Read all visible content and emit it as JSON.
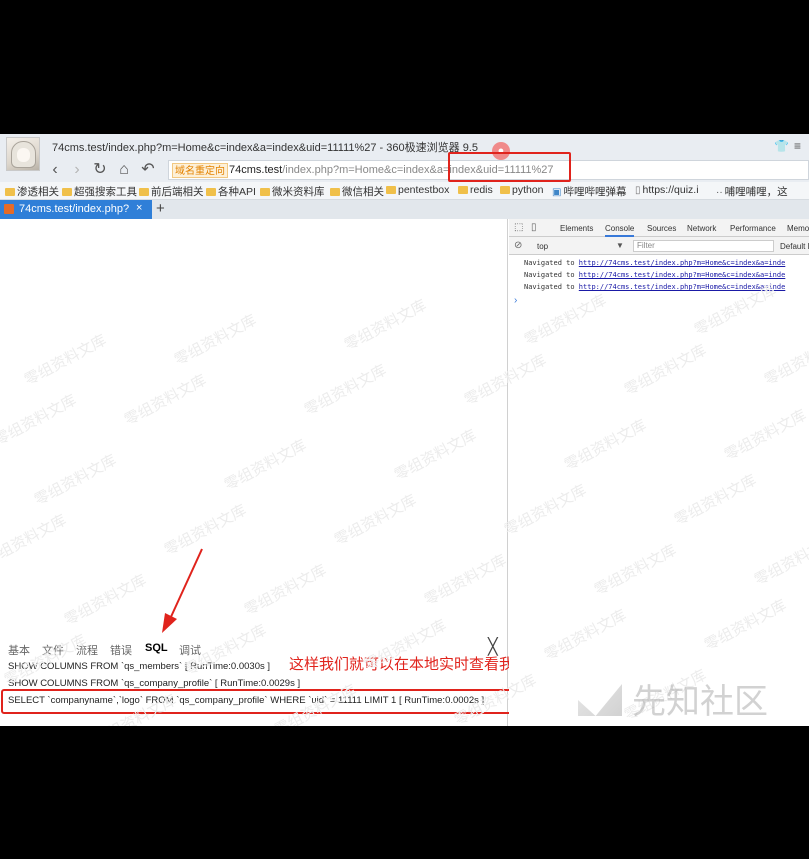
{
  "window": {
    "title": "74cms.test/index.php?m=Home&c=index&a=index&uid=11111%27 - 360极速浏览器 9.5"
  },
  "nav": {
    "back_icon": "‹",
    "forward_icon": "›",
    "reload_icon": "↻",
    "home_icon": "⌂",
    "undo_icon": "↶",
    "redirect_tag": "域名重定向",
    "url_host": "74cms.test",
    "url_path": "/index.php?m=Home&c=index&a=index&uid=11111%27"
  },
  "bookmarks": [
    {
      "label": "渗透相关",
      "icon": "folder"
    },
    {
      "label": "超强搜索工具",
      "icon": "folder"
    },
    {
      "label": "前后端相关",
      "icon": "folder"
    },
    {
      "label": "各种API",
      "icon": "folder"
    },
    {
      "label": "微米资料库",
      "icon": "folder"
    },
    {
      "label": "微信相关",
      "icon": "folder"
    },
    {
      "label": "pentestbox",
      "icon": "folder"
    },
    {
      "label": "redis",
      "icon": "folder"
    },
    {
      "label": "python",
      "icon": "folder"
    },
    {
      "label": "哔哩哔哩弹幕",
      "icon": "bilibili"
    },
    {
      "label": "https://quiz.i",
      "icon": "page"
    },
    {
      "label": "哺哩哺哩，这",
      "icon": "emoticon"
    }
  ],
  "tab": {
    "label": "74cms.test/index.php?",
    "close": "×",
    "new_tab": "+"
  },
  "annotation": "这样我们就可以在本地实时查看我们的代码",
  "debug": {
    "tabs": [
      "基本",
      "文件",
      "流程",
      "错误",
      "SQL",
      "调试"
    ],
    "active_tab": "SQL",
    "close": "╳",
    "sql_lines": [
      "SHOW COLUMNS FROM `qs_members` [ RunTime:0.0030s ]",
      "SHOW COLUMNS FROM `qs_company_profile` [ RunTime:0.0029s ]",
      "SELECT `companyname`,`logo` FROM `qs_company_profile` WHERE `uid` = 11111 LIMIT 1 [ RunTime:0.0002s ]"
    ]
  },
  "devtools": {
    "tabs": [
      "Elements",
      "Console",
      "Sources",
      "Network",
      "Performance",
      "Memo"
    ],
    "active_tab": "Console",
    "context": "top",
    "filter_placeholder": "Filter",
    "default_levels": "Default l",
    "log_prefix": "Navigated to",
    "log_urls": [
      "http://74cms.test/index.php?m=Home&c=index&a=inde",
      "http://74cms.test/index.php?m=Home&c=index&a=inde",
      "http://74cms.test/index.php?m=Home&c=index&a=inde"
    ],
    "prompt": "›"
  },
  "watermark": {
    "text": "零组资料文库",
    "logo_text": "先知社区"
  },
  "colors": {
    "highlight": "#e0231c",
    "tab_active": "#2f7fd8",
    "link": "#1a1aa6"
  }
}
